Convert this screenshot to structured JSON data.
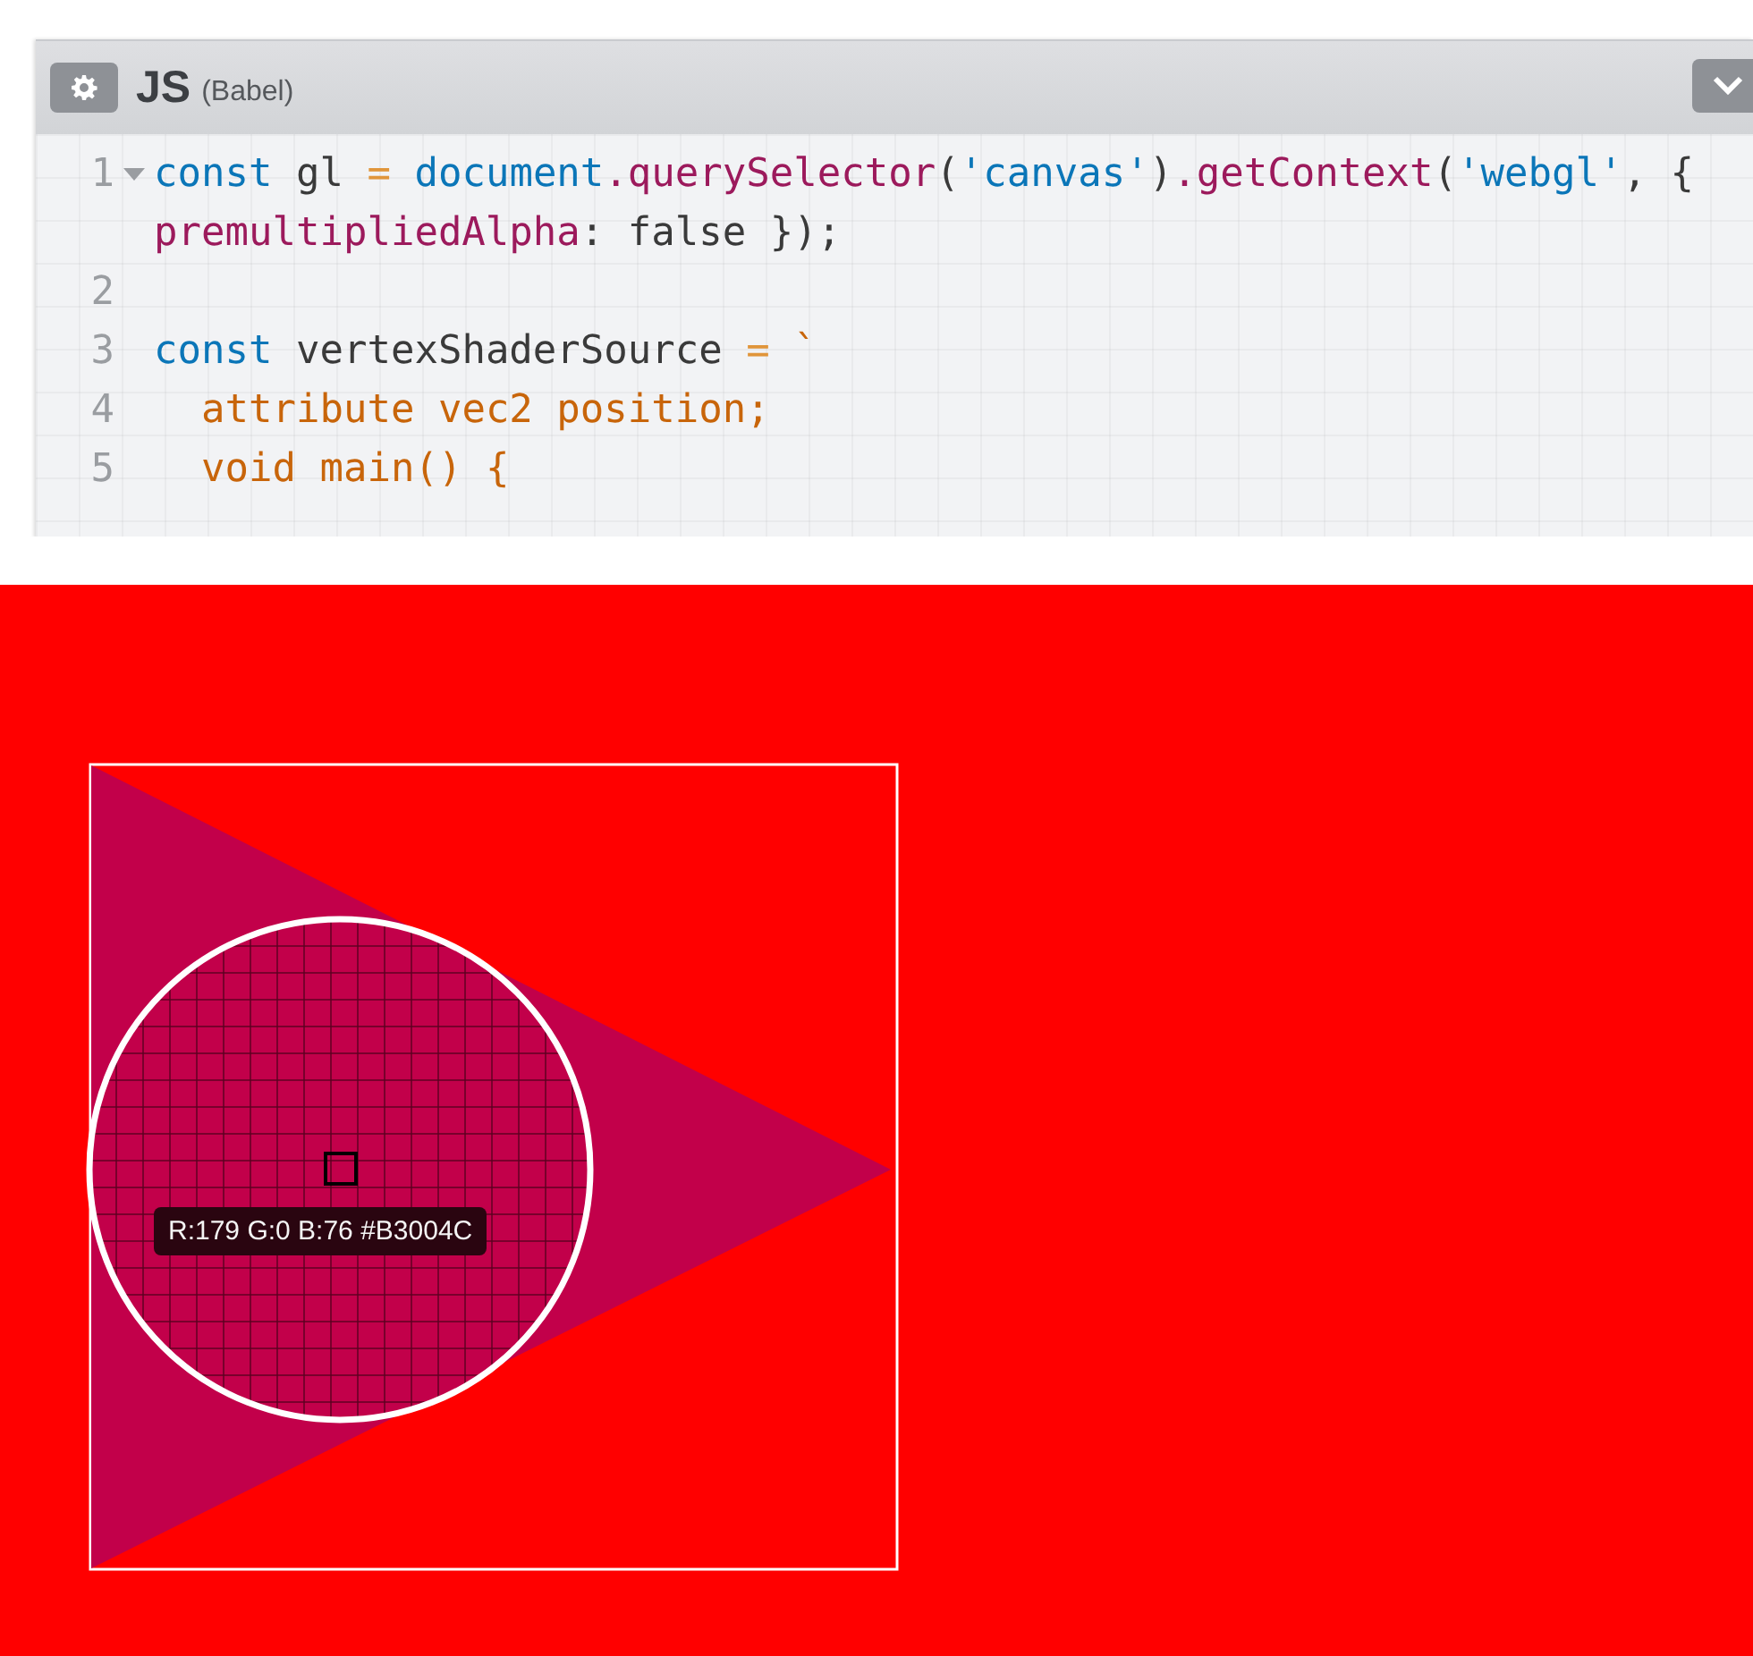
{
  "editor": {
    "language": "JS",
    "preprocessor": "(Babel)",
    "lines": [
      {
        "number": "1",
        "foldable": true,
        "tokens": [
          {
            "text": "const",
            "kind": "keyword"
          },
          {
            "text": " gl ",
            "kind": "plain"
          },
          {
            "text": "=",
            "kind": "operator"
          },
          {
            "text": " document",
            "kind": "builtin"
          },
          {
            "text": ".querySelector",
            "kind": "property"
          },
          {
            "text": "(",
            "kind": "plain"
          },
          {
            "text": "'canvas'",
            "kind": "string"
          },
          {
            "text": ")",
            "kind": "plain"
          },
          {
            "text": ".getContext",
            "kind": "property"
          },
          {
            "text": "(",
            "kind": "plain"
          },
          {
            "text": "'webgl'",
            "kind": "string"
          },
          {
            "text": ", { ",
            "kind": "plain"
          },
          {
            "text": "premultipliedAlpha",
            "kind": "property"
          },
          {
            "text": ": false });",
            "kind": "plain"
          }
        ]
      },
      {
        "number": "2",
        "foldable": false
      },
      {
        "number": "3",
        "foldable": false,
        "tokens": [
          {
            "text": "const",
            "kind": "keyword"
          },
          {
            "text": " vertexShaderSource ",
            "kind": "plain"
          },
          {
            "text": "=",
            "kind": "operator"
          },
          {
            "text": " `",
            "kind": "template"
          }
        ]
      },
      {
        "number": "4",
        "foldable": false,
        "tokens": [
          {
            "text": "  attribute vec2 position;",
            "kind": "template"
          }
        ]
      },
      {
        "number": "5",
        "foldable": false,
        "tokens": [
          {
            "text": "  void main() {",
            "kind": "template"
          }
        ]
      }
    ]
  },
  "canvas": {
    "pixel_readout": "R:179 G:0 B:76 #B3004C"
  }
}
